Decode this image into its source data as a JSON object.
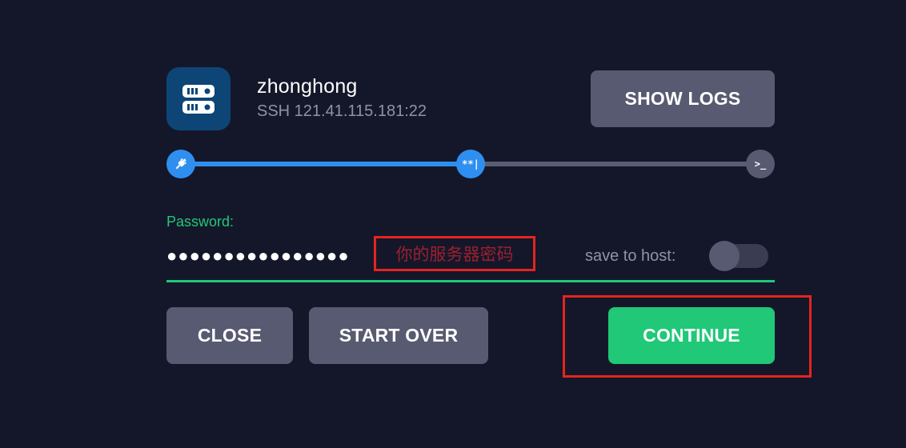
{
  "host": {
    "name": "zhonghong",
    "subtitle": "SSH 121.41.115.181:22",
    "icon": "server-icon",
    "icon_bg": "#0e4577"
  },
  "toolbar": {
    "show_logs_label": "SHOW LOGS"
  },
  "progress": {
    "steps": [
      {
        "icon": "plug-icon",
        "glyph": "",
        "state": "done"
      },
      {
        "icon": "password-icon",
        "glyph": "**|",
        "state": "current"
      },
      {
        "icon": "terminal-icon",
        "glyph": ">_",
        "state": "pending"
      }
    ],
    "completed_fraction": 0.5,
    "active_color": "#2f8ff0",
    "inactive_color": "#5a5d73"
  },
  "password": {
    "label": "Password:",
    "masked_value": "●●●●●●●●●●●●●●●●",
    "accent_color": "#20c877"
  },
  "annotation": {
    "text": "你的服务器密码",
    "color": "#e52420"
  },
  "save_to_host": {
    "label": "save to host:",
    "enabled": false
  },
  "actions": {
    "close_label": "CLOSE",
    "start_over_label": "START OVER",
    "continue_label": "CONTINUE"
  }
}
